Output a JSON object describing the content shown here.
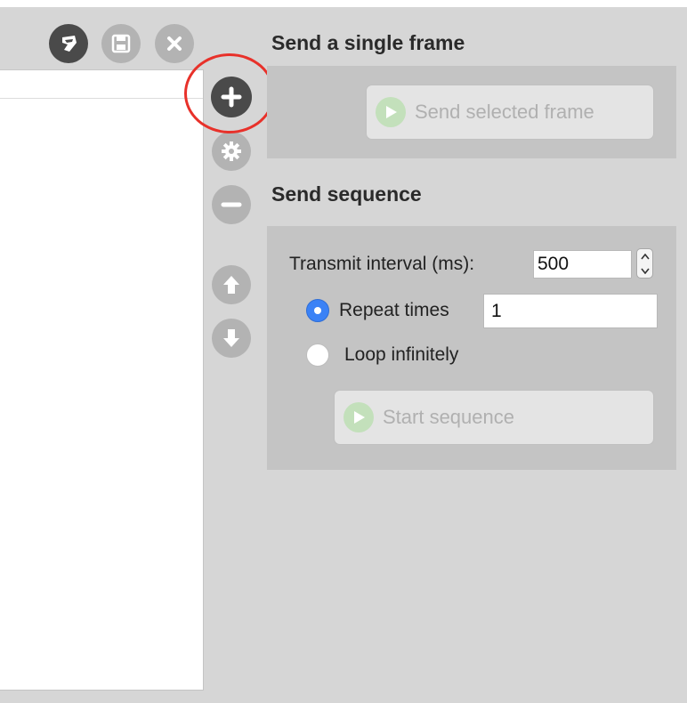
{
  "toolbar": {
    "icons": [
      "broom-icon",
      "save-icon",
      "close-icon"
    ]
  },
  "side_toolbar": {
    "icons": [
      "plus-icon",
      "gear-icon",
      "minus-icon",
      "arrow-up-icon",
      "arrow-down-icon"
    ]
  },
  "single_frame": {
    "title": "Send a single frame",
    "send_button_label": "Send selected frame"
  },
  "sequence": {
    "title": "Send sequence",
    "interval_label": "Transmit interval (ms):",
    "interval_value": "500",
    "repeat_label": "Repeat times",
    "repeat_value": "1",
    "repeat_selected": true,
    "loop_label": "Loop infinitely",
    "loop_selected": false,
    "start_button_label": "Start sequence"
  },
  "colors": {
    "accent_blue": "#3b82f6",
    "highlight_red": "#e8312a",
    "play_green": "#c3e0bb"
  }
}
